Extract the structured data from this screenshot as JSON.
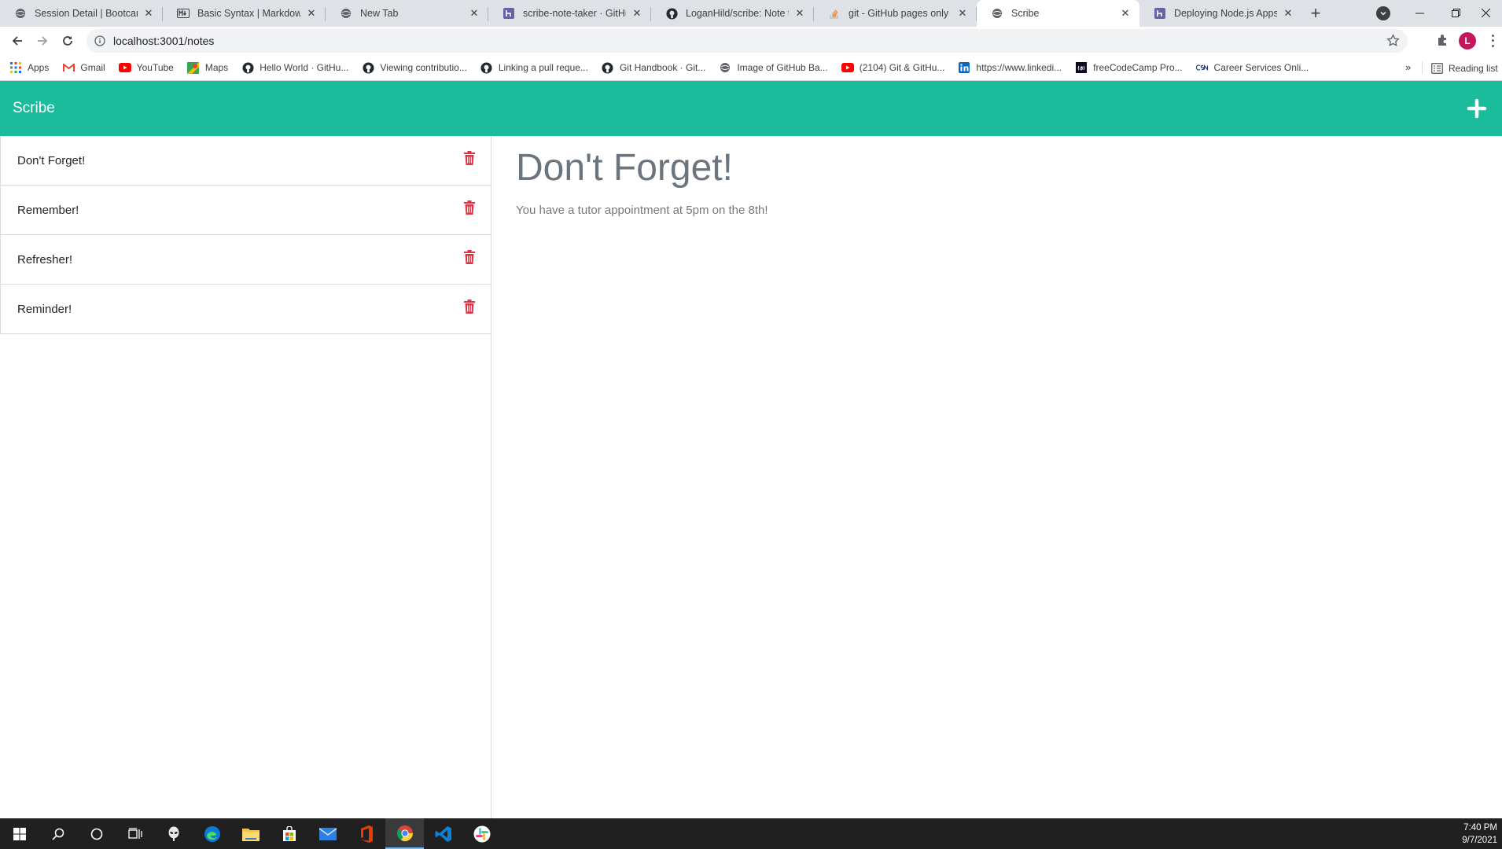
{
  "browser": {
    "tabs": [
      {
        "title": "Session Detail | Bootcamp Spot",
        "icon": "globe-icon"
      },
      {
        "title": "Basic Syntax | Markdown Guide",
        "icon": "markdown-icon"
      },
      {
        "title": "New Tab",
        "icon": "globe-icon"
      },
      {
        "title": "scribe-note-taker · GitHub",
        "icon": "heroku-icon"
      },
      {
        "title": "LoganHild/scribe: Note taker",
        "icon": "github-icon"
      },
      {
        "title": "git - GitHub pages only shows",
        "icon": "stackoverflow-icon"
      },
      {
        "title": "Scribe",
        "icon": "globe-icon",
        "active": true
      },
      {
        "title": "Deploying Node.js Apps on Heroku",
        "icon": "heroku-icon"
      }
    ],
    "url": "localhost:3001/notes",
    "profile_initial": "L",
    "bookmarks": [
      {
        "label": "Apps",
        "icon": "apps-grid-icon"
      },
      {
        "label": "Gmail",
        "icon": "gmail-icon"
      },
      {
        "label": "YouTube",
        "icon": "youtube-icon"
      },
      {
        "label": "Maps",
        "icon": "maps-icon"
      },
      {
        "label": "Hello World · GitHu...",
        "icon": "github-icon"
      },
      {
        "label": "Viewing contributio...",
        "icon": "github-icon"
      },
      {
        "label": "Linking a pull reque...",
        "icon": "github-icon"
      },
      {
        "label": "Git Handbook · Git...",
        "icon": "github-icon"
      },
      {
        "label": "Image of GitHub Ba...",
        "icon": "globe-icon"
      },
      {
        "label": "(2104) Git & GitHu...",
        "icon": "youtube-icon"
      },
      {
        "label": "https://www.linkedi...",
        "icon": "linkedin-icon"
      },
      {
        "label": "freeCodeCamp Pro...",
        "icon": "freecodecamp-icon"
      },
      {
        "label": "Career Services Onli...",
        "icon": "csn-icon"
      }
    ],
    "reading_list": "Reading list"
  },
  "app": {
    "title": "Scribe",
    "notes": [
      {
        "title": "Don't Forget!"
      },
      {
        "title": "Remember!"
      },
      {
        "title": "Refresher!"
      },
      {
        "title": "Reminder!"
      }
    ],
    "active_note": {
      "title": "Don't Forget!",
      "text": "You have a tutor appointment at 5pm on the 8th!"
    },
    "colors": {
      "header": "#1abc9c",
      "trash": "#dc3545"
    }
  },
  "taskbar": {
    "time": "7:40 PM",
    "date": "9/7/2021"
  }
}
